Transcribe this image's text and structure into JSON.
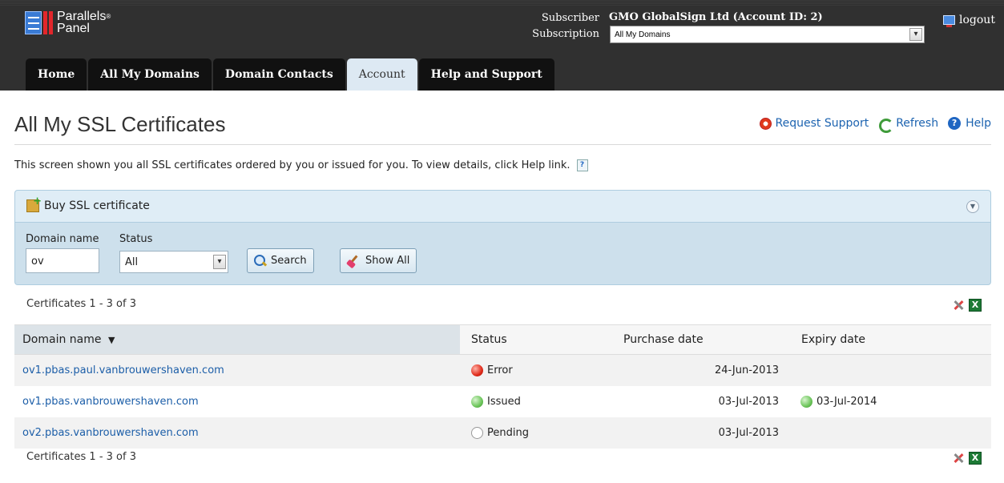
{
  "header": {
    "brand_line1": "Parallels",
    "brand_reg": "®",
    "brand_line2": "Panel",
    "subscriber_label": "Subscriber",
    "subscription_label": "Subscription",
    "subscriber_name": "GMO GlobalSign Ltd (Account ID: 2)",
    "subscription_value": "All My Domains",
    "logout_label": "logout"
  },
  "tabs": [
    {
      "label": "Home",
      "active": false
    },
    {
      "label": "All My Domains",
      "active": false
    },
    {
      "label": "Domain Contacts",
      "active": false
    },
    {
      "label": "Account",
      "active": true
    },
    {
      "label": "Help and Support",
      "active": false
    }
  ],
  "page": {
    "title": "All My SSL Certificates",
    "actions": {
      "request_support": "Request Support",
      "refresh": "Refresh",
      "help": "Help"
    },
    "intro": "This screen shown you all SSL certificates ordered by you or issued for you. To view details, click Help link."
  },
  "buy_panel": {
    "label": "Buy SSL certificate"
  },
  "filter": {
    "domain_label": "Domain name",
    "domain_value": "ov",
    "status_label": "Status",
    "status_value": "All",
    "search_label": "Search",
    "show_all_label": "Show All"
  },
  "results": {
    "count_top": "Certificates 1 - 3 of 3",
    "count_bottom": "Certificates 1 - 3 of 3",
    "columns": {
      "domain": "Domain name",
      "status": "Status",
      "purchase": "Purchase date",
      "expiry": "Expiry date"
    },
    "rows": [
      {
        "domain": "ov1.pbas.paul.vanbrouwershaven.com",
        "status": "Error",
        "status_color": "#e02b1b",
        "purchase": "24-Jun-2013",
        "expiry": ""
      },
      {
        "domain": "ov1.pbas.vanbrouwershaven.com",
        "status": "Issued",
        "status_color": "#6cc55a",
        "purchase": "03-Jul-2013",
        "expiry": "03-Jul-2014"
      },
      {
        "domain": "ov2.pbas.vanbrouwershaven.com",
        "status": "Pending",
        "status_color": "#ffffff",
        "purchase": "03-Jul-2013",
        "expiry": ""
      }
    ]
  },
  "icons": {
    "logo": "parallels-logo-icon",
    "logout": "logout-icon",
    "request_support": "lifebuoy-icon",
    "refresh": "refresh-icon",
    "help": "help-icon",
    "buy": "buy-certificate-icon",
    "collapse": "chevron-down-icon",
    "search": "magnifier-icon",
    "show_all": "broom-icon",
    "tools": "tools-icon",
    "excel": "excel-icon"
  }
}
